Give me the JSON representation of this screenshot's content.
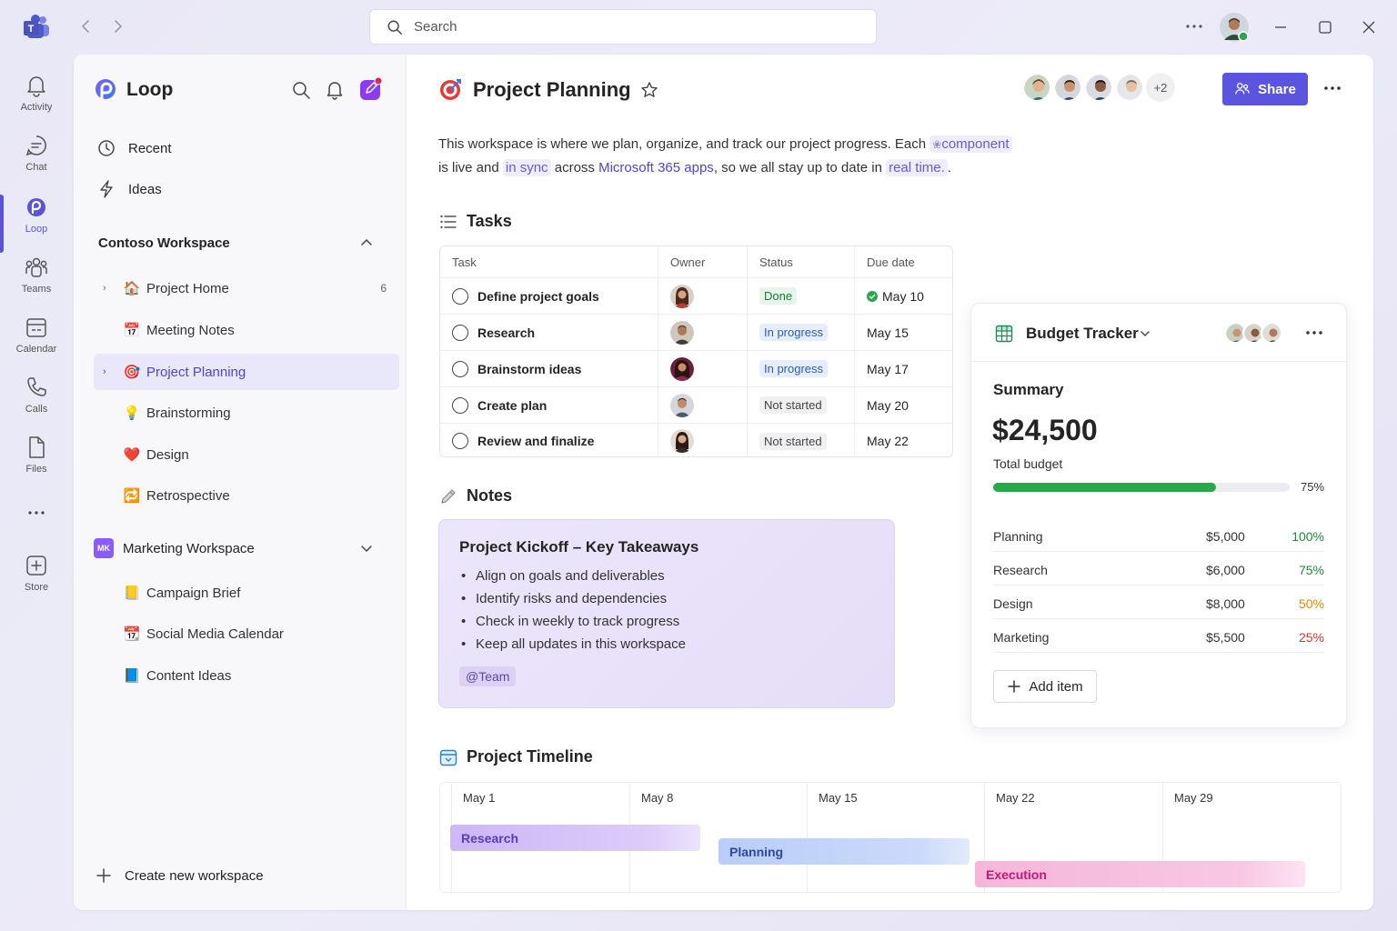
{
  "titlebar": {
    "search_placeholder": "Search"
  },
  "rail": {
    "items": [
      {
        "label": "Activity",
        "icon": "bell-icon"
      },
      {
        "label": "Chat",
        "icon": "chat-icon"
      },
      {
        "label": "Loop",
        "icon": "loop-icon"
      },
      {
        "label": "Teams",
        "icon": "teams-icon"
      },
      {
        "label": "Calendar",
        "icon": "calendar-icon"
      },
      {
        "label": "Calls",
        "icon": "phone-icon"
      },
      {
        "label": "Files",
        "icon": "file-icon"
      },
      {
        "label": "Store",
        "icon": "store-icon"
      }
    ]
  },
  "sidebar": {
    "app_name": "Loop",
    "recent_label": "Recent",
    "ideas_label": "Ideas",
    "workspace_title": "Contoso Workspace",
    "pages": [
      {
        "label": "Project Home",
        "emoji": "🏠",
        "count": "6"
      },
      {
        "label": "Meeting Notes",
        "emoji": "📅",
        "count": ""
      },
      {
        "label": "Project Planning",
        "emoji": "🎯",
        "count": ""
      },
      {
        "label": "Brainstorming",
        "emoji": "💡",
        "count": ""
      },
      {
        "label": "Design",
        "emoji": "❤️",
        "count": ""
      },
      {
        "label": "Retrospective",
        "emoji": "🔁",
        "count": ""
      }
    ],
    "marketing_badge": "MK",
    "marketing_title": "Marketing Workspace",
    "marketing_pages": [
      {
        "label": "Campaign Brief",
        "emoji": "📒"
      },
      {
        "label": "Social Media Calendar",
        "emoji": "📆"
      },
      {
        "label": "Content Ideas",
        "emoji": "📘"
      }
    ],
    "create_label": "Create new workspace"
  },
  "page": {
    "title": "Project Planning",
    "collaborators_more": "+2",
    "share_label": "Share",
    "intro": {
      "p1": "This workspace is where we plan, organize, and track our project progress. Each ",
      "chip1": "component",
      "p2": "is live and ",
      "chip2": "in sync",
      "p3": " across ",
      "link": "Microsoft 365 apps",
      "p4": ", so we all stay up to date in ",
      "chip3": "real time.",
      "p5": "."
    }
  },
  "tasks": {
    "heading": "Tasks",
    "columns": [
      "Task",
      "Owner",
      "Status",
      "Due date"
    ],
    "rows": [
      {
        "task": "Define project goals",
        "status": "Done",
        "status_kind": "done",
        "due": "May 10"
      },
      {
        "task": "Research",
        "status": "In progress",
        "status_kind": "prog",
        "due": "May 15"
      },
      {
        "task": "Brainstorm ideas",
        "status": "In progress",
        "status_kind": "prog",
        "due": "May 17"
      },
      {
        "task": "Create plan",
        "status": "Not started",
        "status_kind": "ns",
        "due": "May 20"
      },
      {
        "task": "Review and finalize",
        "status": "Not started",
        "status_kind": "ns",
        "due": "May 22"
      }
    ]
  },
  "notes": {
    "heading": "Notes",
    "card_title": "Project Kickoff – Key Takeaways",
    "bullets": [
      "Align on goals and deliverables",
      "Identify risks and dependencies",
      "Check in weekly to track progress",
      "Keep all updates in this workspace"
    ],
    "mention": "@Team"
  },
  "budget": {
    "title": "Budget Tracker",
    "summary_label": "Summary",
    "total": "$24,500",
    "total_label": "Total budget",
    "progress": 0.75,
    "progress_label": "75%",
    "rows": [
      {
        "name": "Planning",
        "amount": "$5,000",
        "pct": "100%",
        "color": "#1e8a3a"
      },
      {
        "name": "Research",
        "amount": "$6,000",
        "pct": "75%",
        "color": "#1e8a3a"
      },
      {
        "name": "Design",
        "amount": "$8,000",
        "pct": "50%",
        "color": "#e08a00"
      },
      {
        "name": "Marketing",
        "amount": "$5,500",
        "pct": "25%",
        "color": "#d13438"
      }
    ],
    "add_label": "Add item"
  },
  "timeline": {
    "heading": "Project Timeline",
    "dates": [
      "May 1",
      "May 8",
      "May 15",
      "May 22",
      "May 29"
    ],
    "bars": [
      {
        "label": "Research",
        "color": "#5a3db8"
      },
      {
        "label": "Planning",
        "color": "#2b4aa0"
      },
      {
        "label": "Execution",
        "color": "#c2187a"
      }
    ]
  },
  "colors": {
    "accent": "#5b54e0",
    "progress": "#27a84a"
  }
}
